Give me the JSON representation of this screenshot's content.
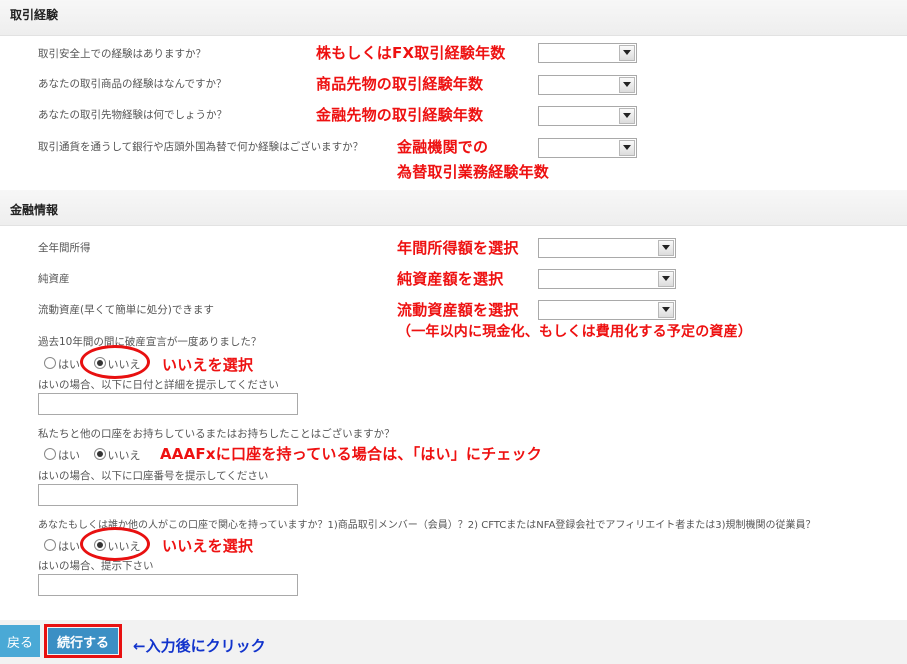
{
  "section1": {
    "title": "取引経験",
    "questions": [
      {
        "label": "取引安全上での経験はありますか？",
        "note": "株もしくはFX取引経験年数"
      },
      {
        "label": "あなたの取引商品の経験はなんですか？",
        "note": "商品先物の取引経験年数"
      },
      {
        "label": "あなたの取引先物経験は何でしょうか？",
        "note": "金融先物の取引経験年数"
      },
      {
        "label": "取引通貨を通うして銀行や店頭外国為替で何か経験はございますか？",
        "note_line1": "金融機関での",
        "note_line2": "為替取引業務経験年数"
      }
    ]
  },
  "section2": {
    "title": "金融情報",
    "income": {
      "label": "全年間所得",
      "note": "年間所得額を選択"
    },
    "net_assets": {
      "label": "純資産",
      "note": "純資産額を選択"
    },
    "liquid_assets": {
      "label": "流動資産(早くて簡単に処分)できます",
      "note": "流動資産額を選択",
      "note_sub": "（一年以内に現金化、もしくは費用化する予定の資産）"
    },
    "bankruptcy": {
      "question": "過去10年間の間に破産宣言が一度ありました？",
      "yes": "はい",
      "no": "いいえ",
      "detail_label": "はいの場合、以下に日付と詳細を提示してください",
      "note": "いいえを選択"
    },
    "other_account": {
      "question": "私たちと他の口座をお持ちしているまたはお持ちしたことはございますか？",
      "yes": "はい",
      "no": "いいえ",
      "detail_label": "はいの場合、以下に口座番号を提示してください",
      "note": "AAAFxに口座を持っている場合は、「はい」にチェック"
    },
    "interest": {
      "question": "あなたもしくは誰か他の人がこの口座で関心を持っていますか？1)商品取引メンバー（会員）？2) CFTCまたはNFA登録会社でアフィリエイト者または3)規制機関の従業員？",
      "yes": "はい",
      "no": "いいえ",
      "detail_label": "はいの場合、提示下さい",
      "note": "いいえを選択"
    }
  },
  "footer": {
    "back_label": "戻る",
    "next_label": "続行する",
    "click_note": "←入力後にクリック"
  },
  "colors": {
    "annotation": "#ee1111",
    "annotation_blue": "#1133cc",
    "button": "#3b8fc4"
  }
}
